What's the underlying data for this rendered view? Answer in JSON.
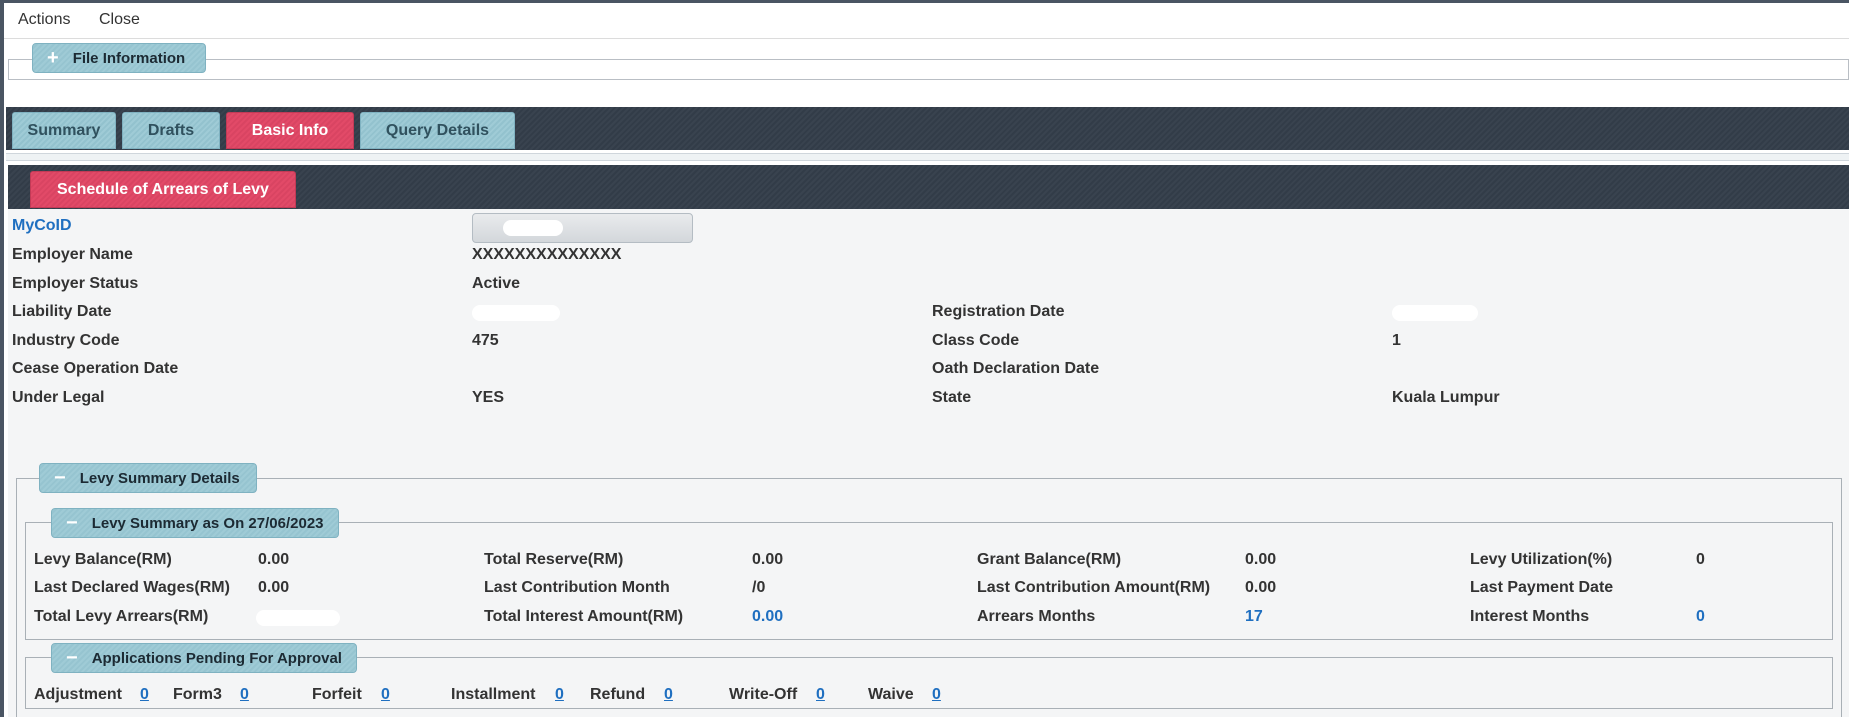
{
  "menu": {
    "actions": "Actions",
    "close": "Close"
  },
  "file_info": {
    "label": "File Information",
    "toggle": "+"
  },
  "tabs": [
    {
      "label": "Summary",
      "active": false
    },
    {
      "label": "Drafts",
      "active": false
    },
    {
      "label": "Basic Info",
      "active": true
    },
    {
      "label": "Query Details",
      "active": false
    }
  ],
  "section_title": "Schedule of Arrears of Levy",
  "basic": {
    "mycoid_label": "MyCoID",
    "employer_name_label": "Employer Name",
    "employer_name": "XXXXXXXXXXXXXX",
    "employer_status_label": "Employer Status",
    "employer_status": "Active",
    "liability_date_label": "Liability Date",
    "registration_date_label": "Registration Date",
    "industry_code_label": "Industry Code",
    "industry_code": "475",
    "class_code_label": "Class Code",
    "class_code": "1",
    "cease_operation_label": "Cease Operation Date",
    "oath_declaration_label": "Oath Declaration Date",
    "under_legal_label": "Under Legal",
    "under_legal": "YES",
    "state_label": "State",
    "state": "Kuala Lumpur"
  },
  "levy_details": {
    "label": "Levy Summary Details",
    "toggle": "−"
  },
  "levy_summary": {
    "label": "Levy Summary as On 27/06/2023",
    "toggle": "−",
    "levy_balance_label": "Levy Balance(RM)",
    "levy_balance": "0.00",
    "total_reserve_label": "Total Reserve(RM)",
    "total_reserve": "0.00",
    "grant_balance_label": "Grant Balance(RM)",
    "grant_balance": "0.00",
    "levy_util_label": "Levy Utilization(%)",
    "levy_util": "0",
    "last_wages_label": "Last Declared Wages(RM)",
    "last_wages": "0.00",
    "last_contrib_month_label": "Last Contribution Month",
    "last_contrib_month": "/0",
    "last_contrib_amount_label": "Last Contribution Amount(RM)",
    "last_contrib_amount": "0.00",
    "last_payment_label": "Last Payment Date",
    "total_arrears_label": "Total Levy Arrears(RM)",
    "total_interest_label": "Total Interest Amount(RM)",
    "total_interest": "0.00",
    "arrears_months_label": "Arrears Months",
    "arrears_months": "17",
    "interest_months_label": "Interest Months",
    "interest_months": "0"
  },
  "pending": {
    "label": "Applications Pending For Approval",
    "toggle": "−",
    "items": [
      {
        "label": "Adjustment",
        "count": "0"
      },
      {
        "label": "Form3",
        "count": "0"
      },
      {
        "label": "Forfeit",
        "count": "0"
      },
      {
        "label": "Installment",
        "count": "0"
      },
      {
        "label": "Refund",
        "count": "0"
      },
      {
        "label": "Write-Off",
        "count": "0"
      },
      {
        "label": "Waive",
        "count": "0"
      }
    ]
  }
}
